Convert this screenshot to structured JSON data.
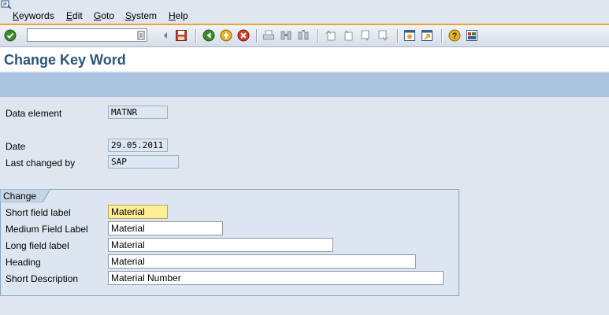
{
  "menu": {
    "items": [
      {
        "label": "Keywords",
        "underline": "K",
        "rest": "eywords"
      },
      {
        "label": "Edit",
        "underline": "E",
        "rest": "dit"
      },
      {
        "label": "Goto",
        "underline": "G",
        "rest": "oto"
      },
      {
        "label": "System",
        "underline": "S",
        "rest": "ystem"
      },
      {
        "label": "Help",
        "underline": "H",
        "rest": "elp"
      }
    ]
  },
  "toolbar": {
    "command_value": ""
  },
  "page": {
    "title": "Change Key Word"
  },
  "header_fields": {
    "data_element": {
      "label": "Data element",
      "value": "MATNR"
    },
    "date": {
      "label": "Date",
      "value": "29.05.2011"
    },
    "last_changed_by": {
      "label": "Last changed by",
      "value": "SAP"
    }
  },
  "group": {
    "title": "Change",
    "fields": {
      "short": {
        "label": "Short field label",
        "value": "Material"
      },
      "medium": {
        "label": "Medium Field Label",
        "value": "Material"
      },
      "long": {
        "label": "Long field label",
        "value": "Material"
      },
      "heading": {
        "label": "Heading",
        "value": "Material"
      },
      "short_desc": {
        "label": "Short Description",
        "value": "Material Number"
      }
    }
  },
  "colors": {
    "title": "#2a5578",
    "appbar": "#a9c2de",
    "focus_field": "#ffee95",
    "accent_line": "#e8a33d"
  }
}
